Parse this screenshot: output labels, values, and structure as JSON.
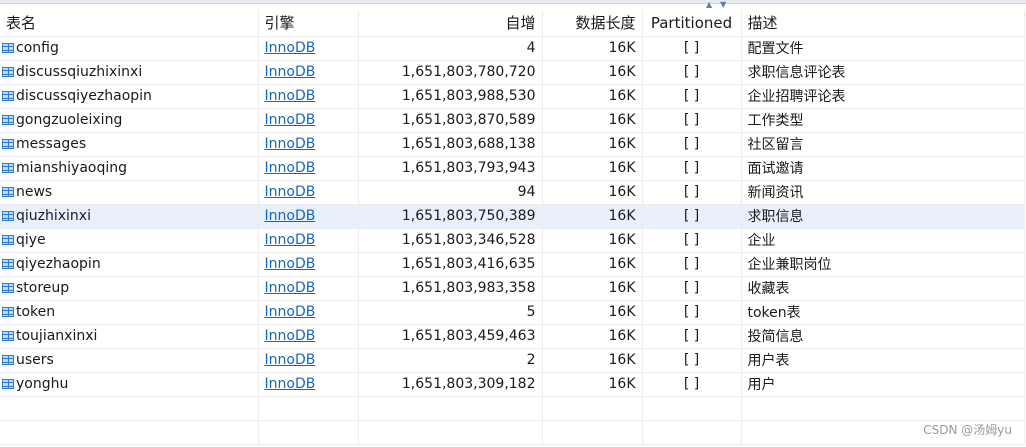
{
  "columns": {
    "name": "表名",
    "engine": "引擎",
    "auto_increment": "自增",
    "data_length": "数据长度",
    "partitioned": "Partitioned",
    "description": "描述"
  },
  "rows": [
    {
      "name": "config",
      "engine": "InnoDB",
      "auto_increment": "4",
      "data_length": "16K",
      "partitioned": "[ ]",
      "description": "配置文件"
    },
    {
      "name": "discussqiuzhixinxi",
      "engine": "InnoDB",
      "auto_increment": "1,651,803,780,720",
      "data_length": "16K",
      "partitioned": "[ ]",
      "description": "求职信息评论表"
    },
    {
      "name": "discussqiyezhaopin",
      "engine": "InnoDB",
      "auto_increment": "1,651,803,988,530",
      "data_length": "16K",
      "partitioned": "[ ]",
      "description": "企业招聘评论表"
    },
    {
      "name": "gongzuoleixing",
      "engine": "InnoDB",
      "auto_increment": "1,651,803,870,589",
      "data_length": "16K",
      "partitioned": "[ ]",
      "description": "工作类型"
    },
    {
      "name": "messages",
      "engine": "InnoDB",
      "auto_increment": "1,651,803,688,138",
      "data_length": "16K",
      "partitioned": "[ ]",
      "description": "社区留言"
    },
    {
      "name": "mianshiyaoqing",
      "engine": "InnoDB",
      "auto_increment": "1,651,803,793,943",
      "data_length": "16K",
      "partitioned": "[ ]",
      "description": "面试邀请"
    },
    {
      "name": "news",
      "engine": "InnoDB",
      "auto_increment": "94",
      "data_length": "16K",
      "partitioned": "[ ]",
      "description": "新闻资讯"
    },
    {
      "name": "qiuzhixinxi",
      "engine": "InnoDB",
      "auto_increment": "1,651,803,750,389",
      "data_length": "16K",
      "partitioned": "[ ]",
      "description": "求职信息",
      "selected": true
    },
    {
      "name": "qiye",
      "engine": "InnoDB",
      "auto_increment": "1,651,803,346,528",
      "data_length": "16K",
      "partitioned": "[ ]",
      "description": "企业"
    },
    {
      "name": "qiyezhaopin",
      "engine": "InnoDB",
      "auto_increment": "1,651,803,416,635",
      "data_length": "16K",
      "partitioned": "[ ]",
      "description": "企业兼职岗位"
    },
    {
      "name": "storeup",
      "engine": "InnoDB",
      "auto_increment": "1,651,803,983,358",
      "data_length": "16K",
      "partitioned": "[ ]",
      "description": "收藏表"
    },
    {
      "name": "token",
      "engine": "InnoDB",
      "auto_increment": "5",
      "data_length": "16K",
      "partitioned": "[ ]",
      "description": "token表"
    },
    {
      "name": "toujianxinxi",
      "engine": "InnoDB",
      "auto_increment": "1,651,803,459,463",
      "data_length": "16K",
      "partitioned": "[ ]",
      "description": "投简信息"
    },
    {
      "name": "users",
      "engine": "InnoDB",
      "auto_increment": "2",
      "data_length": "16K",
      "partitioned": "[ ]",
      "description": "用户表"
    },
    {
      "name": "yonghu",
      "engine": "InnoDB",
      "auto_increment": "1,651,803,309,182",
      "data_length": "16K",
      "partitioned": "[ ]",
      "description": "用户"
    }
  ],
  "watermark": "CSDN @汤姆yu",
  "colors": {
    "link": "#1565c0",
    "selected_row": "#e8f1fb",
    "table_icon": "#2e7bd0"
  },
  "icons": {
    "table": "table-icon"
  }
}
